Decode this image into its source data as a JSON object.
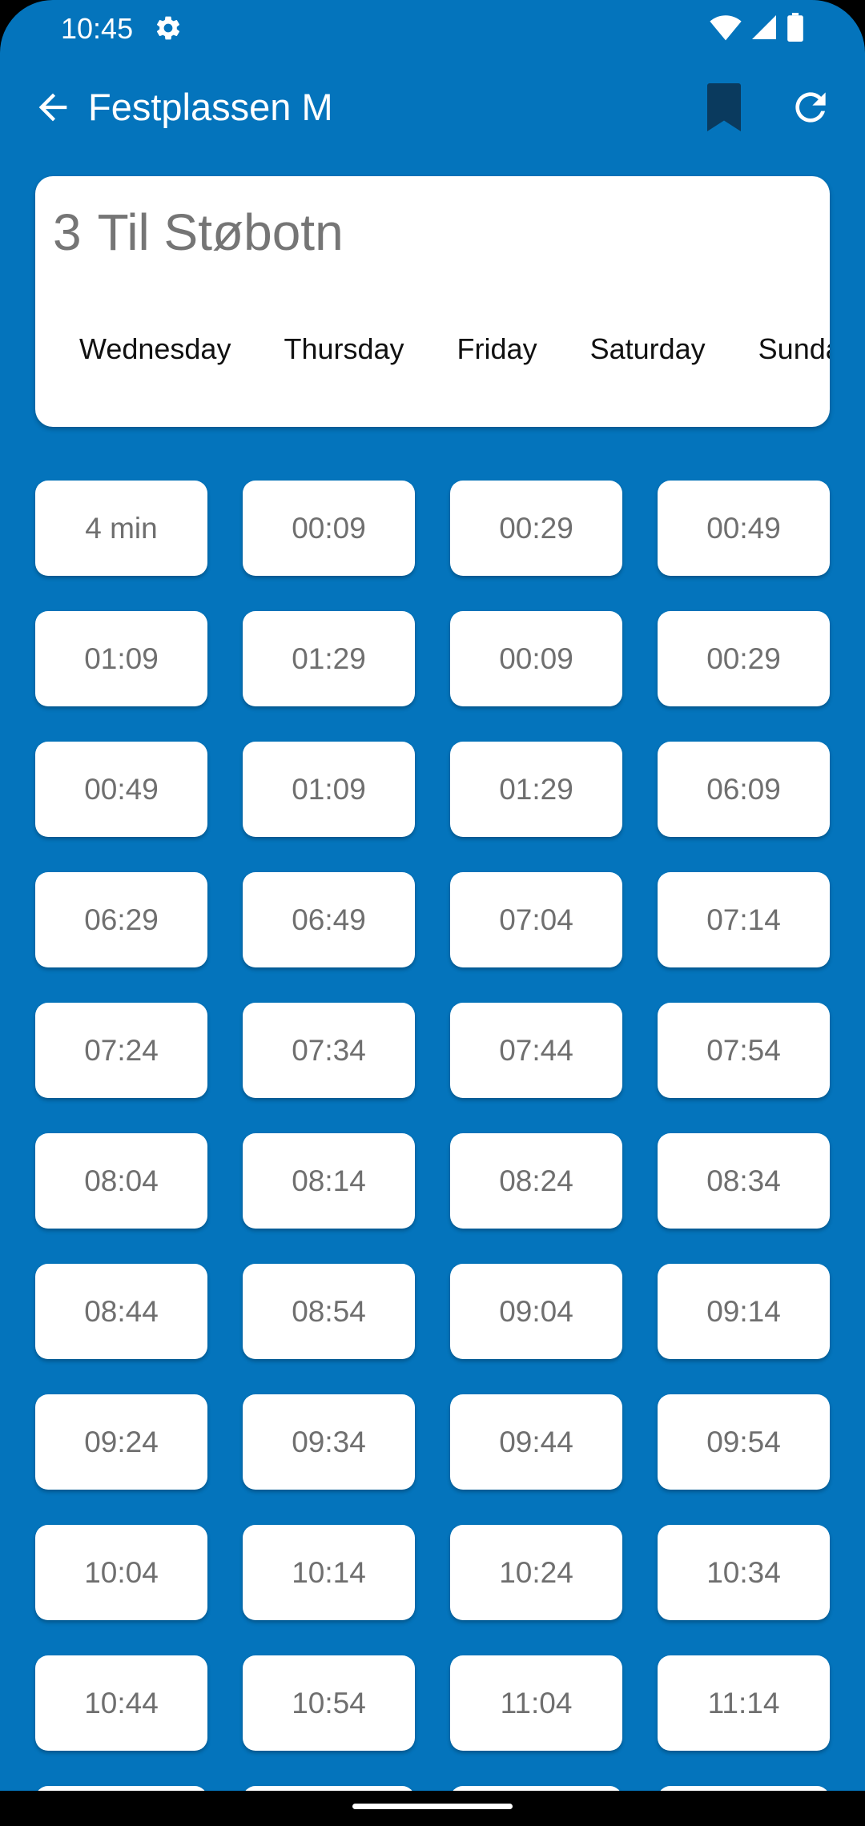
{
  "status_bar": {
    "time": "10:45",
    "icons": [
      "gear-icon",
      "wifi-icon",
      "signal-icon",
      "battery-icon"
    ]
  },
  "app_bar": {
    "title": "Festplassen M",
    "back_icon": "arrow-back-icon",
    "bookmark_icon": "bookmark-icon",
    "refresh_icon": "refresh-icon"
  },
  "route": {
    "number": "3",
    "destination": "Til Støbotn"
  },
  "day_tabs": [
    "Wednesday",
    "Thursday",
    "Friday",
    "Saturday",
    "Sunday"
  ],
  "departures": [
    "4 min",
    "00:09",
    "00:29",
    "00:49",
    "01:09",
    "01:29",
    "00:09",
    "00:29",
    "00:49",
    "01:09",
    "01:29",
    "06:09",
    "06:29",
    "06:49",
    "07:04",
    "07:14",
    "07:24",
    "07:34",
    "07:44",
    "07:54",
    "08:04",
    "08:14",
    "08:24",
    "08:34",
    "08:44",
    "08:54",
    "09:04",
    "09:14",
    "09:24",
    "09:34",
    "09:44",
    "09:54",
    "10:04",
    "10:14",
    "10:24",
    "10:34",
    "10:44",
    "10:54",
    "11:04",
    "11:14"
  ],
  "colors": {
    "background": "#0474BC",
    "card": "#FFFFFF",
    "bookmark": "#0A3A5E",
    "time_text": "#6F6F6F"
  }
}
